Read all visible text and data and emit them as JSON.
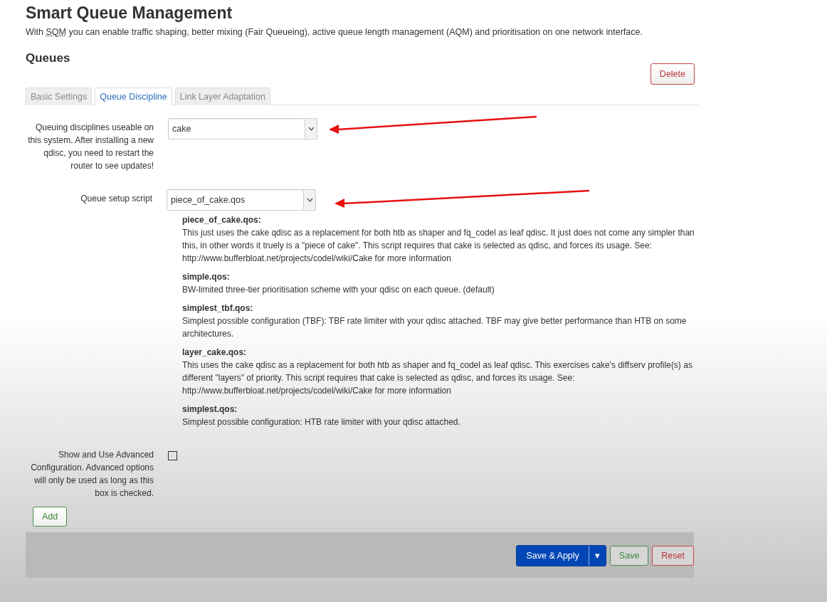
{
  "page": {
    "title": "Smart Queue Management",
    "description": {
      "before": "With ",
      "abbr": "SQM",
      "after": " you can enable traffic shaping, better mixing (Fair Queueing), active queue length management (AQM) and prioritisation on one network interface."
    }
  },
  "section": {
    "title": "Queues",
    "delete_button": "Delete"
  },
  "tabs": [
    {
      "label": "Basic Settings",
      "selected": false
    },
    {
      "label": "Queue Discipline",
      "selected": true
    },
    {
      "label": "Link Layer Adaptation",
      "selected": false
    }
  ],
  "fields": [
    {
      "kind": "select",
      "label": "Queuing disciplines useable on this system. After installing a new qdisc, you need to restart the router to see updates!",
      "value": "cake",
      "annotated": true
    },
    {
      "kind": "select",
      "label": "Queue setup script",
      "value": "piece_of_cake.qos",
      "annotated": true,
      "scripts": [
        {
          "name": "piece_of_cake.qos:",
          "text": "This just uses the cake qdisc as a replacement for both htb as shaper and fq_codel as leaf qdisc. It just does not come any simpler than this, in other words it truely is a \"piece of cake\". This script requires that cake is selected as qdisc, and forces its usage. See: http://www.bufferbloat.net/projects/codel/wiki/Cake for more information"
        },
        {
          "name": "simple.qos:",
          "text": "BW-limited three-tier prioritisation scheme with your qdisc on each queue. (default)"
        },
        {
          "name": "simplest_tbf.qos:",
          "text": "Simplest possible configuration (TBF): TBF rate limiter with your qdisc attached. TBF may give better performance than HTB on some architectures."
        },
        {
          "name": "layer_cake.qos:",
          "text": "This uses the cake qdisc as a replacement for both htb as shaper and fq_codel as leaf qdisc. This exercises cake's diffserv profile(s) as different \"layers\" of priority. This script requires that cake is selected as qdisc, and forces its usage. See: http://www.bufferbloat.net/projects/codel/wiki/Cake for more information"
        },
        {
          "name": "simplest.qos:",
          "text": "Simplest possible configuration: HTB rate limiter with your qdisc attached."
        }
      ]
    },
    {
      "kind": "checkbox",
      "label": "Show and Use Advanced Configuration. Advanced options will only be used as long as this box is checked.",
      "checked": false
    }
  ],
  "add_button": "Add",
  "footer": {
    "save_apply": "Save & Apply",
    "dropdown": "▾",
    "save": "Save",
    "reset": "Reset"
  }
}
